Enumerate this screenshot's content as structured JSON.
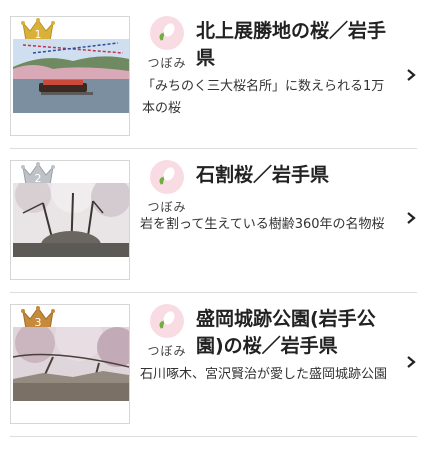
{
  "items": [
    {
      "rank": "1",
      "bloom_status": "つぼみ",
      "title": "北上展勝地の桜／岩手県",
      "description": "「みちのく三大桜名所」に数えられる1万本の桜"
    },
    {
      "rank": "2",
      "bloom_status": "つぼみ",
      "title": "石割桜／岩手県",
      "description": "岩を割って生えている樹齢360年の名物桜"
    },
    {
      "rank": "3",
      "bloom_status": "つぼみ",
      "title": "盛岡城跡公園(岩手公園)の桜／岩手県",
      "description": "石川啄木、宮沢賢治が愛した盛岡城跡公園"
    }
  ],
  "colors": {
    "gold_crown": "#d9b13a",
    "silver_crown": "#bfc3c8",
    "bronze_crown": "#c58a3a",
    "bloom_circle": "#f9dbe4",
    "divider": "#dddddd"
  },
  "icons": {
    "crown": "crown-icon",
    "bloom": "cherry-bud-icon",
    "chevron": "chevron-right-icon"
  }
}
